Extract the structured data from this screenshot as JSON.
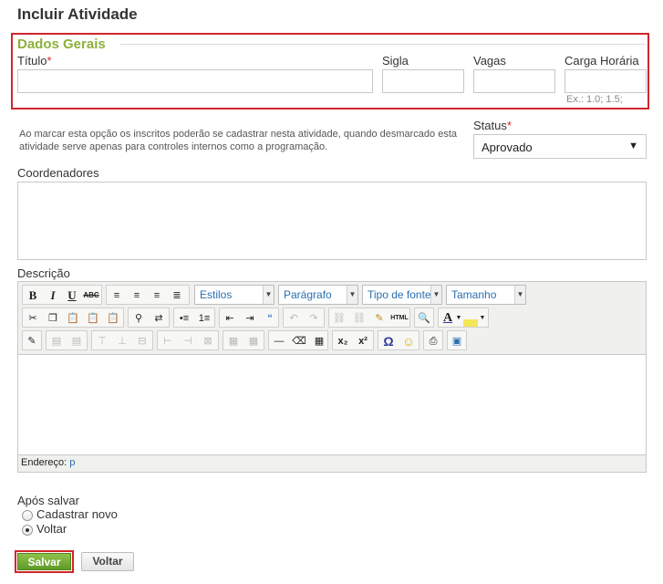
{
  "page": {
    "title": "Incluir Atividade"
  },
  "general": {
    "legend": "Dados Gerais",
    "titulo_label": "Título",
    "required_mark": "*",
    "sigla_label": "Sigla",
    "vagas_label": "Vagas",
    "carga_label": "Carga Horária",
    "carga_hint": "Ex.: 1.0; 1.5;",
    "titulo_value": "",
    "sigla_value": "",
    "vagas_value": "",
    "carga_value": ""
  },
  "info_note": "Ao marcar esta opção os inscritos poderão se cadastrar nesta atividade, quando desmarcado esta atividade serve apenas para controles internos como a programação.",
  "status": {
    "label": "Status",
    "required_mark": "*",
    "value": "Aprovado",
    "arrow": "▼"
  },
  "coordenadores": {
    "label": "Coordenadores",
    "value": ""
  },
  "descricao": {
    "label": "Descrição",
    "toolbar": {
      "styles_drop": "Estilos",
      "format_drop": "Parágrafo",
      "font_drop": "Tipo de fonte",
      "size_drop": "Tamanho",
      "bold": "B",
      "italic": "I",
      "underline": "U",
      "strike": "ABC",
      "html_btn": "HTML",
      "omega": "Ω",
      "sub": "x₂",
      "sup": "x²"
    },
    "statusbar_label": "Endereço:",
    "statusbar_path": "p"
  },
  "after_save": {
    "label": "Após salvar",
    "options": [
      "Cadastrar novo",
      "Voltar"
    ],
    "selected": "Voltar"
  },
  "buttons": {
    "save": "Salvar",
    "back": "Voltar"
  },
  "colors": {
    "accent_green": "#8cb03a",
    "required_red": "#d0262b",
    "link_blue": "#2a6fb0"
  }
}
